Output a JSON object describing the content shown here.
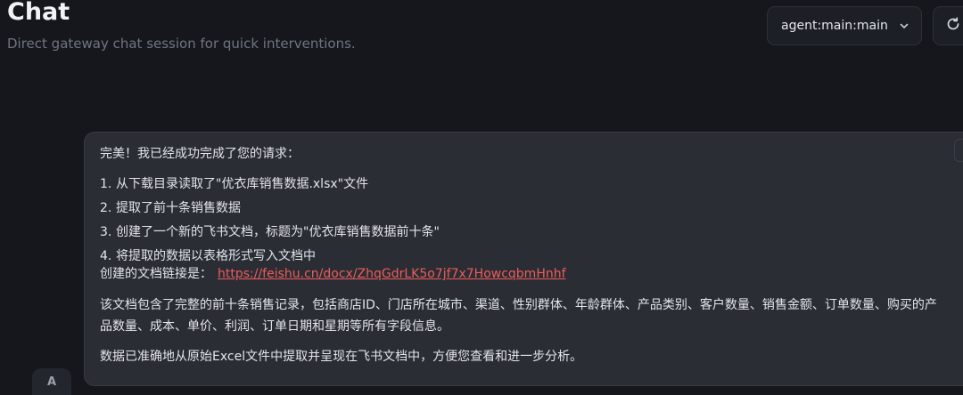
{
  "header": {
    "title": "Chat",
    "subtitle": "Direct gateway chat session for quick interventions."
  },
  "session_select": {
    "value": "agent:main:main",
    "icon": "chevron-down-icon"
  },
  "refresh": {
    "icon": "refresh-icon"
  },
  "message": {
    "avatar_letter": "A",
    "intro": "完美！我已经成功完成了您的请求：",
    "steps": [
      {
        "num": "1.",
        "text": "从下载目录读取了\"优衣库销售数据.xlsx\"文件"
      },
      {
        "num": "2.",
        "text": "提取了前十条销售数据"
      },
      {
        "num": "3.",
        "text": "创建了一个新的飞书文档，标题为\"优衣库销售数据前十条\""
      },
      {
        "num": "4.",
        "text": "将提取的数据以表格形式写入文档中"
      }
    ],
    "link_label": "创建的文档链接是：",
    "link_url": "https://feishu.cn/docx/ZhqGdrLK5o7jf7x7HowcqbmHnhf",
    "paragraph1": "该文档包含了完整的前十条销售记录，包括商店ID、门店所在城市、渠道、性别群体、年龄群体、产品类别、客户数量、销售金额、订单数量、购买的产品数量、成本、单价、利润、订单日期和星期等所有字段信息。",
    "paragraph2": "数据已准确地从原始Excel文件中提取并呈现在飞书文档中，方便您查看和进一步分析。"
  },
  "colors": {
    "background": "#15171c",
    "bubble": "#2a2d34",
    "link": "#ef5b5b"
  }
}
